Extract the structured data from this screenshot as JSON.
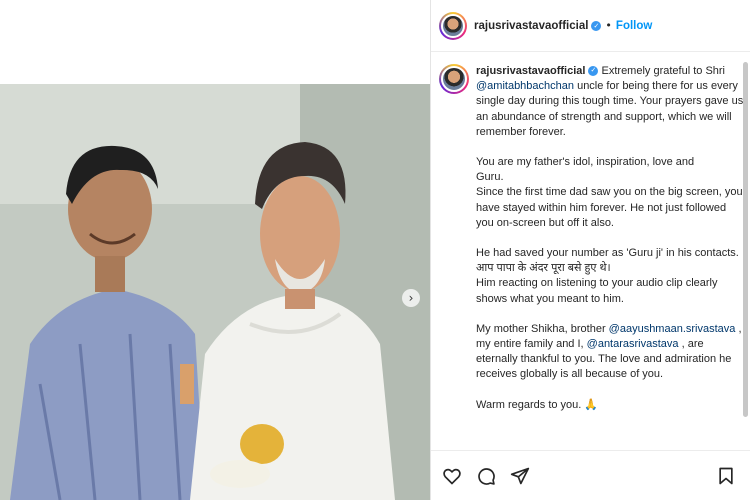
{
  "post": {
    "username": "rajusrivastavaofficial",
    "verified_icon": "verified-badge-icon",
    "follow_label": "Follow",
    "separator": "•"
  },
  "caption": {
    "username": "rajusrivastavaofficial",
    "p1_a": " Extremely grateful to Shri ",
    "p1_mention": "@amitabhbachchan",
    "p1_b": " uncle for being there for us every single day during this tough time. Your prayers gave us an abundance of strength and support, which we will remember forever.",
    "p2_line1": "You are my father's idol, inspiration, love and",
    "p2_line2": "Guru.",
    "p2_line3": "Since the first time dad saw you on the big screen, you have stayed within him forever. He not just followed you on-screen but off it also.",
    "p3_line1": "He had saved your number as 'Guru ji' in his contacts. आप पापा के अंदर पूरा बसे हुए थे।",
    "p3_line2": "Him reacting on listening to your audio clip clearly shows what you meant to him.",
    "p4_a": "My mother Shikha, brother ",
    "p4_mention1": "@aayushmaan.srivastava",
    "p4_b": " , my entire family and I, ",
    "p4_mention2": "@antarasrivastava",
    "p4_c": " , are eternally thankful to you. The love and admiration he receives globally is all because of you.",
    "p5": "Warm regards to you. 🙏"
  },
  "icons": {
    "like": "heart-icon",
    "comment": "comment-icon",
    "share": "share-icon",
    "save": "bookmark-icon",
    "next": "chevron-right-icon"
  },
  "colors": {
    "link": "#0095f6",
    "mention": "#00376b",
    "text": "#262626"
  }
}
